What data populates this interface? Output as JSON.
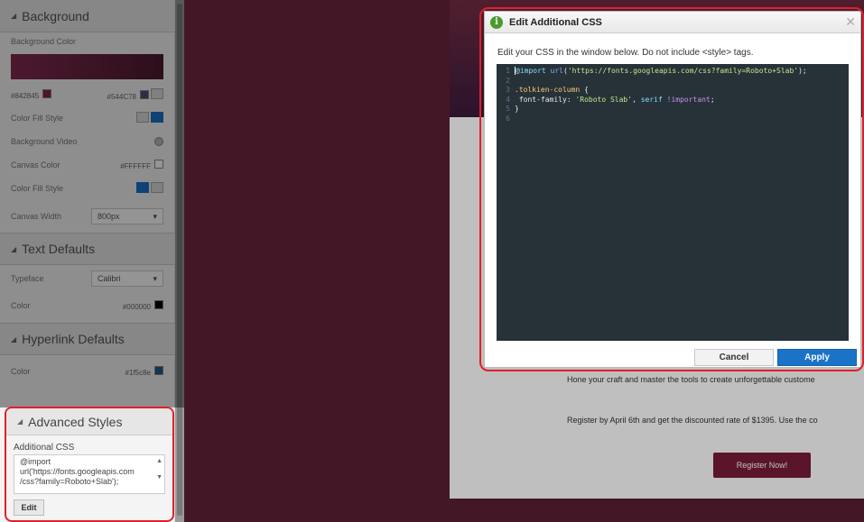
{
  "sidebar": {
    "background": {
      "header": "Background",
      "bg_color_label": "Background Color",
      "gradient_start": "#842845",
      "gradient_end": "#544C78",
      "fill_style_label": "Color Fill Style",
      "bg_video_label": "Background Video",
      "canvas_color_label": "Canvas Color",
      "canvas_color_value": "#FFFFFF",
      "canvas_fill_style_label": "Color Fill Style",
      "canvas_width_label": "Canvas Width",
      "canvas_width_value": "800px"
    },
    "text_defaults": {
      "header": "Text Defaults",
      "typeface_label": "Typeface",
      "typeface_value": "Calibri",
      "color_label": "Color",
      "color_value": "#000000"
    },
    "hyperlink_defaults": {
      "header": "Hyperlink Defaults",
      "color_label": "Color",
      "color_value": "#1f5c8e"
    },
    "advanced": {
      "header": "Advanced Styles",
      "css_label": "Additional CSS",
      "css_value_lines": [
        "@import",
        "url('https://fonts.googleapis.com",
        "/css?family=Roboto+Slab');"
      ],
      "edit_label": "Edit"
    }
  },
  "page": {
    "line1": "Hone your craft and master the tools to create unforgettable custome",
    "line2": "Register by April 6th and get the discounted rate of $1395. Use the co",
    "register_label": "Register Now!"
  },
  "modal": {
    "title": "Edit Additional CSS",
    "description": "Edit your CSS in the window below. Do not include <style> tags.",
    "line_numbers": [
      "1",
      "2",
      "3",
      "4",
      "5",
      "6"
    ],
    "code": {
      "l1_at": "@import",
      "l1_fn": "url",
      "l1_str": "'https://fonts.googleapis.com/css?family=Roboto+Slab'",
      "l3_sel": ".tolkien-column",
      "l4_prop": "font-family",
      "l4_str": "'Roboto Slab'",
      "l4_kw": "serif",
      "l4_imp": "!important"
    },
    "cancel_label": "Cancel",
    "apply_label": "Apply"
  },
  "colors": {
    "apply": "#1a73c8",
    "highlight": "#e0202a",
    "info": "#4a9a2c"
  }
}
